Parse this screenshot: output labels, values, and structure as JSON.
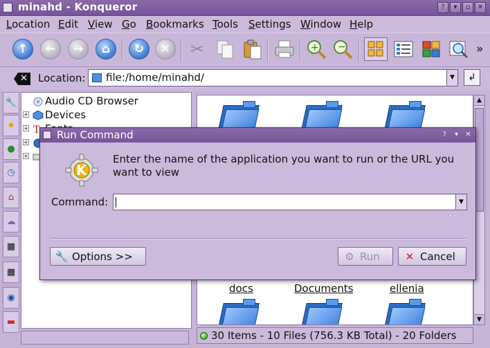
{
  "window": {
    "title": "minahd - Konqueror",
    "controls": [
      "?",
      "▾",
      "▫",
      "✕"
    ]
  },
  "menubar": {
    "items": [
      "Location",
      "Edit",
      "View",
      "Go",
      "Bookmarks",
      "Tools",
      "Settings",
      "Window",
      "Help"
    ]
  },
  "toolbar": {
    "buttons": [
      "up-arrow-icon",
      "back-arrow-icon",
      "forward-arrow-icon",
      "home-icon",
      "reload-icon",
      "stop-icon",
      "cut-icon",
      "copy-icon",
      "paste-icon",
      "print-icon",
      "zoom-in-icon",
      "zoom-out-icon",
      "icon-view-icon",
      "detail-view-icon",
      "multi-column-icon",
      "preview-icon"
    ],
    "overflow": "»"
  },
  "location": {
    "label": "Location:",
    "value": "file:/home/minahd/"
  },
  "tree": {
    "items": [
      {
        "label": "Audio CD Browser",
        "expander": ""
      },
      {
        "label": "Devices",
        "expander": "+"
      },
      {
        "label": "Fonts",
        "expander": "+"
      }
    ]
  },
  "fileview": {
    "labels": [
      "docs",
      "Documents",
      "ellenia"
    ]
  },
  "status": {
    "text": "30 Items - 10 Files (756.3 KB Total) - 20 Folders"
  },
  "dialog": {
    "title": "Run Command",
    "message": "Enter the name of the application you want to run or the URL you want to view",
    "command_label": "Command:",
    "command_value": "",
    "options_label": "Options >>",
    "run_label": "Run",
    "cancel_label": "Cancel"
  },
  "colors": {
    "titlebar": "#7d5ca0",
    "background": "#cbbadb",
    "accent": "#3c7ad0"
  }
}
